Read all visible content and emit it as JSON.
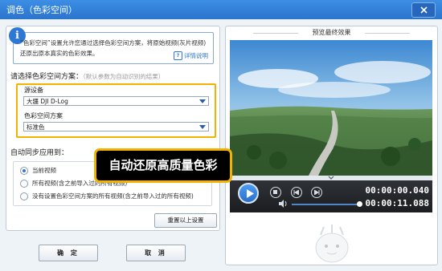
{
  "window": {
    "title": "调色（色彩空间）"
  },
  "info": {
    "icon": "i",
    "text": "“色彩空间”设置允许您通过选择色彩空间方案，将原始视频(灰片视频)还原出原本真实的色彩效果。",
    "help_label": "详情说明",
    "help_icon_text": "?"
  },
  "color_space": {
    "section_label": "请选择色彩空间方案：",
    "hint": "（默认参数为自动识别的结果）",
    "source_device_label": "源设备",
    "source_device_value": "大疆 DJI D-Log",
    "scheme_label": "色彩空间方案",
    "scheme_value": "标准色"
  },
  "sync": {
    "label": "自动同步应用到：",
    "options": [
      {
        "label": "当前视频",
        "selected": true
      },
      {
        "label": "所有视频(含之前导入过的所有视频)",
        "selected": false
      },
      {
        "label": "没有设置色彩空间方案的所有视频(含之前导入过的所有视频)",
        "selected": false
      }
    ]
  },
  "buttons": {
    "reset": "重置以上设置",
    "ok": "确 定",
    "cancel": "取 消"
  },
  "preview": {
    "title": "预览最终效果",
    "current_time": "00:00:00.040",
    "total_time": "00:00:11.088"
  },
  "callout": {
    "text": "自动还原高质量色彩"
  },
  "colors": {
    "accent": "#2d78d5",
    "highlight": "#f2b200",
    "titlebar": "#2a74cc"
  }
}
